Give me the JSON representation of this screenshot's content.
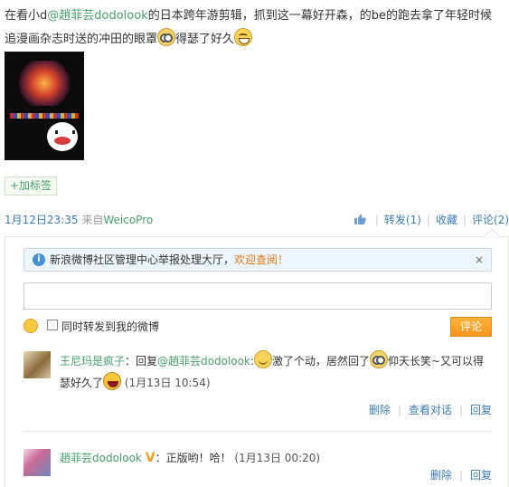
{
  "post": {
    "text_before": "在看小d",
    "mention": "@趙菲芸dodolook",
    "text_after": "的日本跨年游剪辑，抓到这一幕好开森，的be的跑去拿了年轻时候追漫画杂志时送的冲田的眼罩",
    "text_end": "得瑟了好久",
    "emoji_1": "glasses-emoji",
    "emoji_2": "grin-emoji"
  },
  "tag_button": "+加标签",
  "meta": {
    "time": "1月12日23:35",
    "from_label": "来自",
    "source": "WeicoPro"
  },
  "actions": {
    "like_icon": "thumbs-up-icon",
    "repost": "转发(1)",
    "favorite": "收藏",
    "comment": "评论(2)"
  },
  "notice": {
    "text": "新浪微博社区管理中心举报处理大厅，",
    "link": "欢迎查阅！",
    "close": "×"
  },
  "composer": {
    "input_value": "",
    "checkbox_label": "同时转发到我的微博",
    "submit": "评论"
  },
  "comments": [
    {
      "user": "王尼玛是疯子",
      "reply_prefix": "：回复",
      "reply_to": "@趙菲芸dodolook",
      "text_1": ":",
      "text_2": "激了个动，居然回了",
      "text_3": "仰天长笑~又可以得瑟好久了",
      "time": "(1月13日 10:54)",
      "delete": "删除",
      "view_dialog": "查看对话",
      "reply": "回复"
    },
    {
      "user": "趙菲芸dodolook",
      "vip": "V",
      "text": "：正版哟！哈！",
      "time": "(1月13日 00:20)",
      "delete": "删除",
      "reply": "回复"
    }
  ]
}
